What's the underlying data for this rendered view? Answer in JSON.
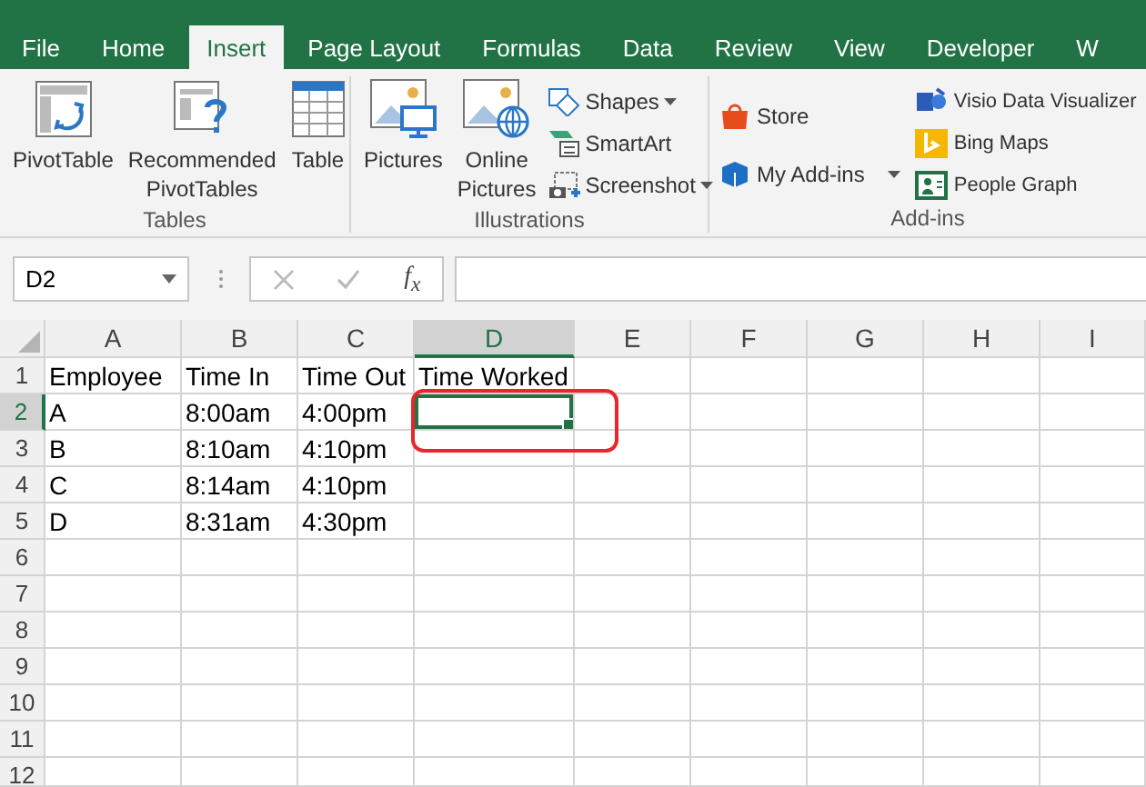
{
  "tabs": [
    {
      "label": "File",
      "selected": false
    },
    {
      "label": "Home",
      "selected": false
    },
    {
      "label": "Insert",
      "selected": true
    },
    {
      "label": "Page Layout",
      "selected": false
    },
    {
      "label": "Formulas",
      "selected": false
    },
    {
      "label": "Data",
      "selected": false
    },
    {
      "label": "Review",
      "selected": false
    },
    {
      "label": "View",
      "selected": false
    },
    {
      "label": "Developer",
      "selected": false
    },
    {
      "label": "W",
      "selected": false
    }
  ],
  "ribbon_groups": [
    {
      "label": "Tables",
      "items": [
        {
          "kind": "large",
          "label": "PivotTable"
        },
        {
          "kind": "large",
          "label": "Recommended PivotTables"
        },
        {
          "kind": "large",
          "label": "Table"
        }
      ]
    },
    {
      "label": "Illustrations",
      "items": [
        {
          "kind": "large",
          "label": "Pictures"
        },
        {
          "kind": "large",
          "label": "Online Pictures"
        },
        {
          "kind": "small",
          "label": "Shapes",
          "dropdown": true
        },
        {
          "kind": "small",
          "label": "SmartArt"
        },
        {
          "kind": "small",
          "label": "Screenshot",
          "dropdown": true
        }
      ]
    },
    {
      "label": "Add-ins",
      "items": [
        {
          "kind": "small",
          "label": "Store"
        },
        {
          "kind": "small",
          "label": "My Add-ins",
          "dropdown": true
        },
        {
          "kind": "small",
          "label": "Visio Data Visualizer"
        },
        {
          "kind": "small",
          "label": "Bing Maps"
        },
        {
          "kind": "small",
          "label": "People Graph"
        }
      ]
    }
  ],
  "formula_bar": {
    "name_box": "D2",
    "function_label": "f$_{x}$"
  },
  "columns": [
    {
      "label": "A",
      "selected": false
    },
    {
      "label": "B",
      "selected": false
    },
    {
      "label": "C",
      "selected": false
    },
    {
      "label": "D",
      "selected": true
    },
    {
      "label": "E",
      "selected": false
    },
    {
      "label": "F",
      "selected": false
    },
    {
      "label": "G",
      "selected": false
    },
    {
      "label": "H",
      "selected": false
    },
    {
      "label": "I",
      "selected": false
    }
  ],
  "rows": [
    {
      "header": "1",
      "selected": false,
      "cells": [
        "Employee",
        "Time In",
        "Time Out",
        "Time Worked"
      ]
    },
    {
      "header": "2",
      "selected": true,
      "cells": [
        "A",
        "8:00am",
        "4:00pm"
      ]
    },
    {
      "header": "3",
      "selected": false,
      "cells": [
        "B",
        "8:10am",
        "4:10pm"
      ]
    },
    {
      "header": "4",
      "selected": false,
      "cells": [
        "C",
        "8:14am",
        "4:10pm"
      ]
    },
    {
      "header": "5",
      "selected": false,
      "cells": [
        "D",
        "8:31am",
        "4:30pm"
      ]
    },
    {
      "header": "6",
      "selected": false,
      "cells": []
    },
    {
      "header": "7",
      "selected": false,
      "cells": []
    },
    {
      "header": "8",
      "selected": false,
      "cells": []
    },
    {
      "header": "9",
      "selected": false,
      "cells": []
    },
    {
      "header": "10",
      "selected": false,
      "cells": []
    },
    {
      "header": "11",
      "selected": false,
      "cells": []
    },
    {
      "header": "12",
      "selected": false,
      "cells": []
    }
  ],
  "annotation": {
    "kind": "outline"
  }
}
